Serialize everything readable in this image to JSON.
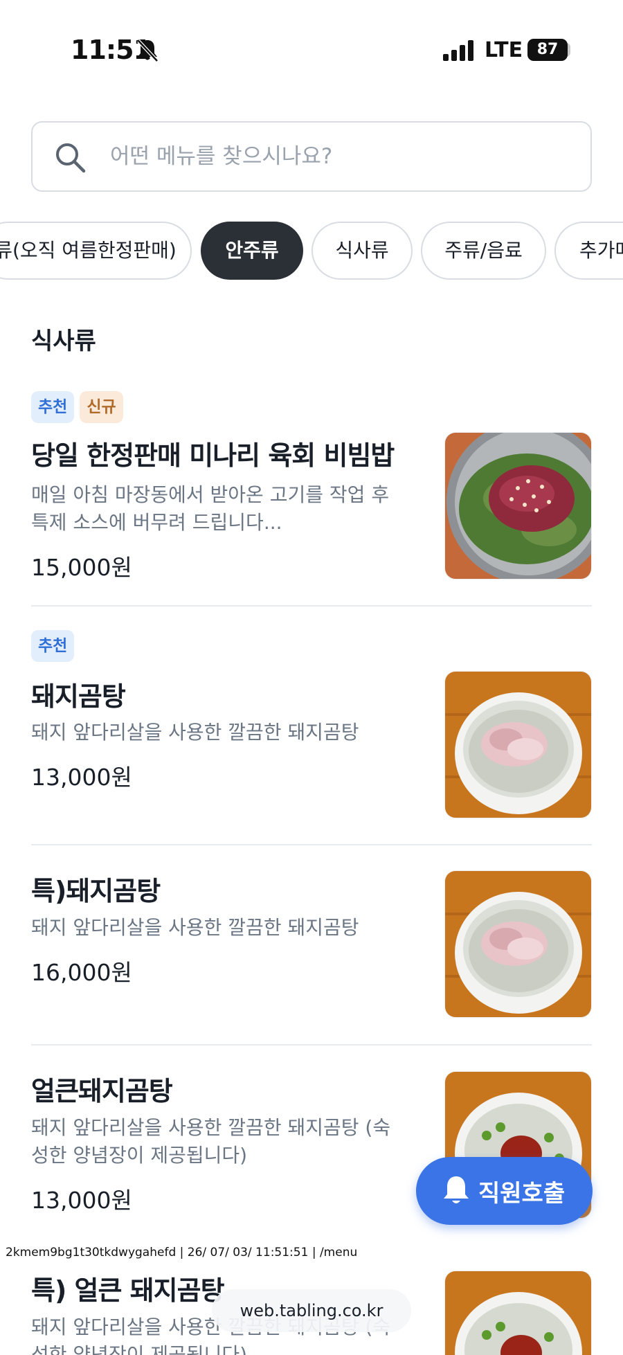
{
  "status_bar": {
    "time": "11:51",
    "network": "LTE",
    "battery": "87",
    "icons": [
      "bell-slash-icon",
      "signal-icon",
      "battery-icon"
    ]
  },
  "search": {
    "placeholder": "어떤 메뉴를 찾으시나요?",
    "icon": "search-icon"
  },
  "categories": [
    {
      "label": "류(오직 여름한정판매)",
      "active": false
    },
    {
      "label": "안주류",
      "active": true
    },
    {
      "label": "식사류",
      "active": false
    },
    {
      "label": "주류/음료",
      "active": false
    },
    {
      "label": "추가메뉴",
      "active": false
    }
  ],
  "section": {
    "title": "식사류"
  },
  "tags": {
    "recommended": "추천",
    "new": "신규"
  },
  "menu_items": [
    {
      "name": "당일 한정판매 미나리 육회 비빔밥",
      "description": "매일 아침 마장동에서 받아온 고기를 작업 후 특제 소스에 버무려 드립니다...",
      "price": "15,000원",
      "tags": [
        "추천",
        "신규"
      ]
    },
    {
      "name": "돼지곰탕",
      "description": "돼지 앞다리살을 사용한 깔끔한 돼지곰탕",
      "price": "13,000원",
      "tags": [
        "추천"
      ]
    },
    {
      "name": "특)돼지곰탕",
      "description": "돼지 앞다리살을 사용한 깔끔한 돼지곰탕",
      "price": "16,000원",
      "tags": []
    },
    {
      "name": "얼큰돼지곰탕",
      "description": "돼지 앞다리살을 사용한 깔끔한 돼지곰탕 (숙성한 양념장이 제공됩니다)",
      "price": "13,000원",
      "tags": []
    },
    {
      "name": "특) 얼큰 돼지곰탕",
      "description": "돼지 앞다리살을 사용한 깔끔한 돼지곰탕 (숙성한 양념장이 제공됩니다)",
      "price": "",
      "tags": []
    }
  ],
  "fab": {
    "label": "직원호출",
    "icon": "bell-icon"
  },
  "debug_text": "2kmem9bg1t30tkdwygahefd | 26/ 07/ 03/ 11:51:51 | /menu",
  "url": "web.tabling.co.kr",
  "colors": {
    "accent": "#3b74e6",
    "active_chip": "#2b2f36",
    "tag_recommended": "#2f6fd6",
    "tag_new": "#b06b2a"
  }
}
